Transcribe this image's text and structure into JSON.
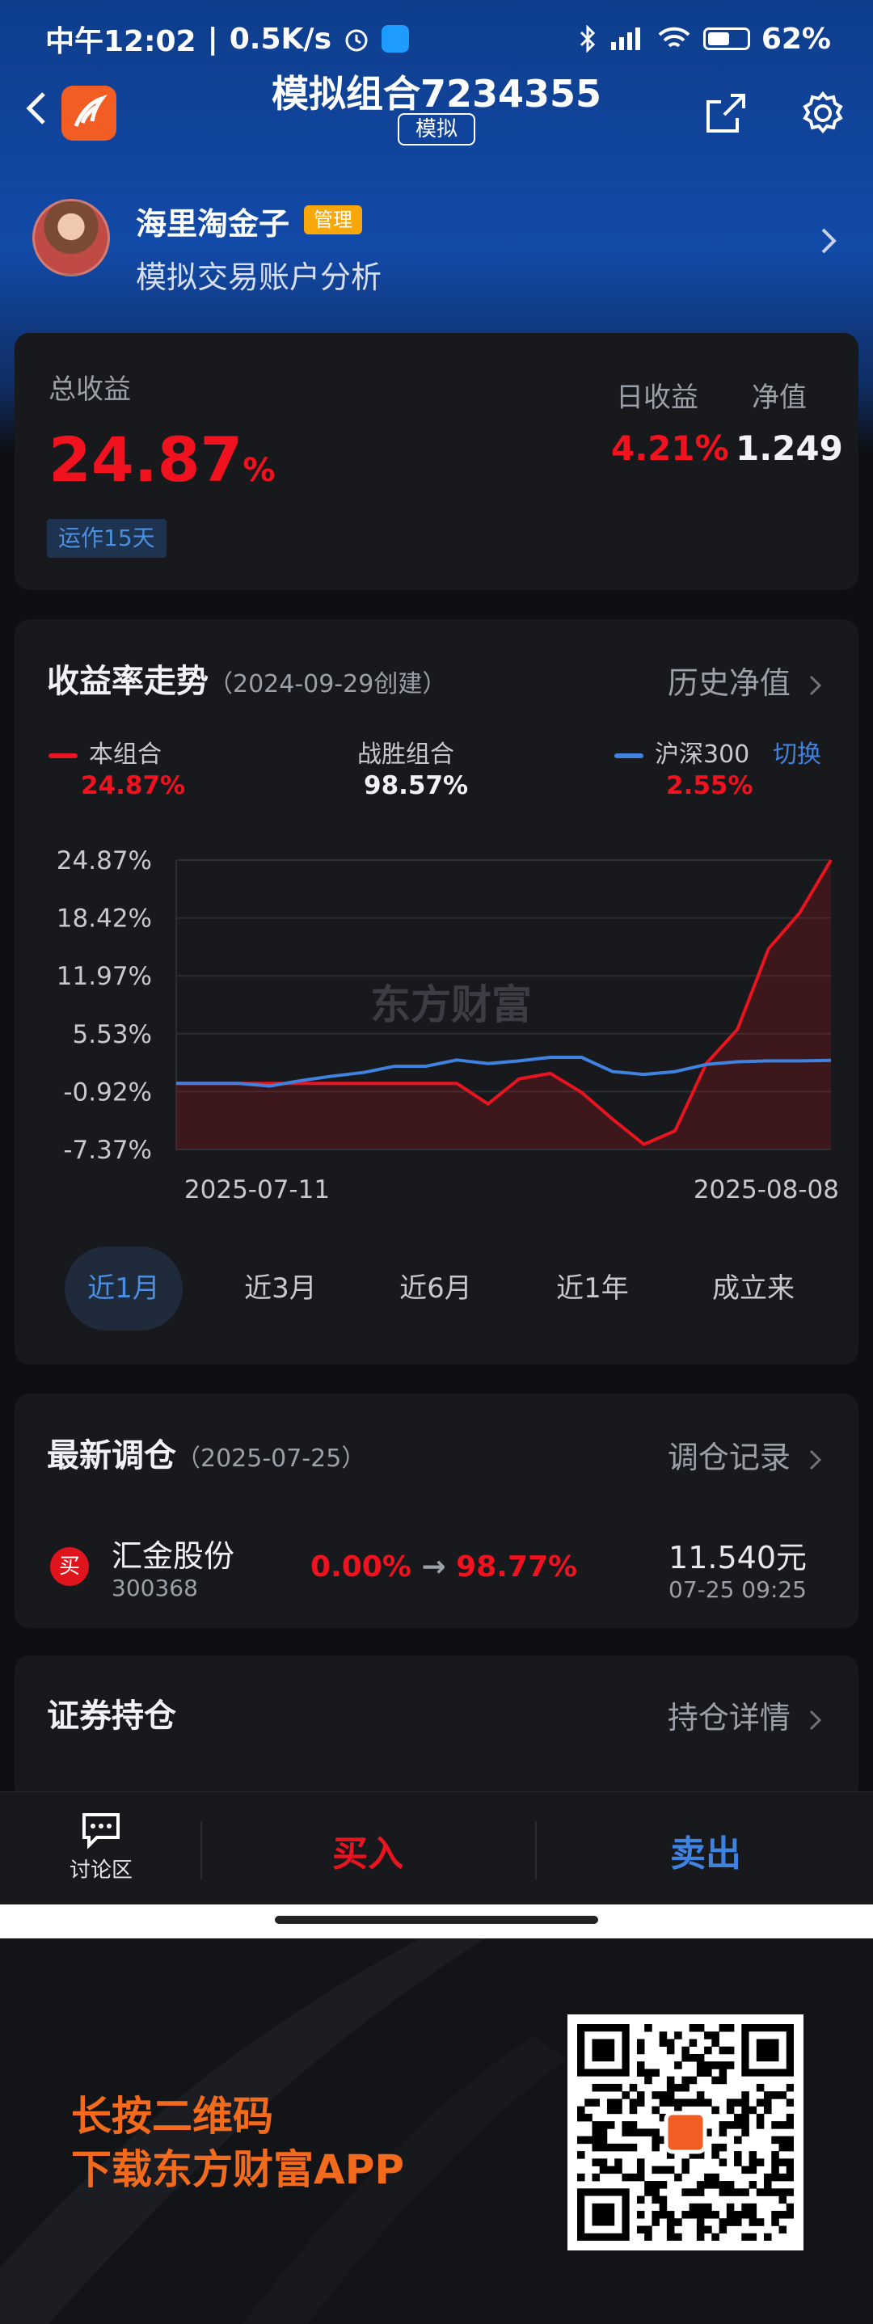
{
  "status_bar": {
    "time": "中午12:02",
    "speed": "0.5K/s",
    "battery": "62%"
  },
  "nav": {
    "title": "模拟组合7234355",
    "tag": "模拟"
  },
  "user": {
    "name": "海里淘金子",
    "badge": "管理",
    "subtitle": "模拟交易账户分析"
  },
  "summary": {
    "total_label": "总收益",
    "total_value": "24.87",
    "total_unit": "%",
    "run_tag": "运作15天",
    "daily_label": "日收益",
    "daily_value": "4.21%",
    "nav_label": "净值",
    "nav_value": "1.249"
  },
  "trend": {
    "title": "收益率走势",
    "created": "（2024-09-29创建）",
    "history_link": "历史净值",
    "switch_label": "切换",
    "legend": [
      {
        "name": "本组合",
        "value": "24.87%"
      },
      {
        "name": "战胜组合",
        "value": "98.57%"
      },
      {
        "name": "沪深300",
        "value": "2.55%"
      }
    ],
    "watermark": "东方财富",
    "ranges": [
      "近1月",
      "近3月",
      "近6月",
      "近1年",
      "成立来"
    ],
    "active_range": "近1月"
  },
  "chart_data": {
    "type": "line",
    "x_start": "2025-07-11",
    "x_end": "2025-08-08",
    "y_ticks": [
      "24.87%",
      "18.42%",
      "11.97%",
      "5.53%",
      "-0.92%",
      "-7.37%"
    ],
    "ylim": [
      -7.37,
      24.87
    ],
    "series": [
      {
        "name": "本组合",
        "color": "#e8141f",
        "values": [
          0,
          0,
          0,
          0,
          0,
          0,
          0,
          0,
          0,
          0,
          -2.3,
          0.5,
          1.1,
          -1.0,
          -4.0,
          -6.8,
          -5.3,
          2.2,
          6.0,
          15.0,
          19.0,
          24.87
        ]
      },
      {
        "name": "沪深300",
        "color": "#3f82e0",
        "values": [
          0,
          0,
          0,
          -0.3,
          0.3,
          0.8,
          1.2,
          1.9,
          1.9,
          2.6,
          2.2,
          2.5,
          2.9,
          2.9,
          1.3,
          1.0,
          1.3,
          2.1,
          2.4,
          2.5,
          2.5,
          2.55
        ]
      }
    ]
  },
  "rebalance": {
    "title": "最新调仓",
    "date": "（2025-07-25）",
    "link": "调仓记录",
    "action": "买",
    "stock_name": "汇金股份",
    "stock_code": "300368",
    "from_pct": "0.00%",
    "arrow": "→",
    "to_pct": "98.77%",
    "price": "11.540元",
    "time": "07-25  09:25"
  },
  "holdings": {
    "title": "证券持仓",
    "link": "持仓详情"
  },
  "bottom_bar": {
    "discuss": "讨论区",
    "buy": "买入",
    "sell": "卖出"
  },
  "promo": {
    "line1": "长按二维码",
    "line2": "下载东方财富APP"
  },
  "colors": {
    "red": "#f0121e",
    "blue": "#3f82e0",
    "accent_orange": "#f26a1b"
  }
}
